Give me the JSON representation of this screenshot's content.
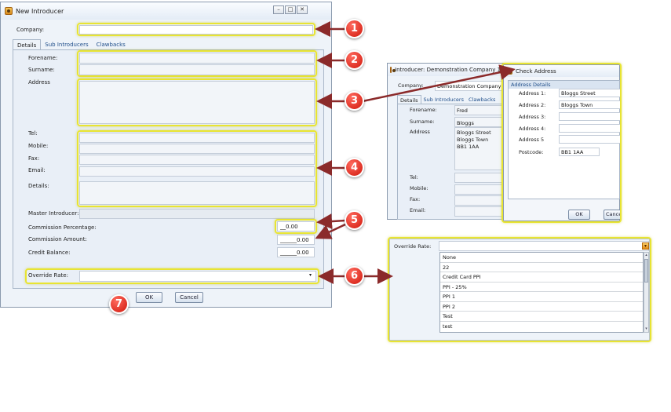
{
  "new_introducer": {
    "title": "New Introducer",
    "company_label": "Company:",
    "tabs": [
      "Details",
      "Sub Introducers",
      "Clawbacks"
    ],
    "forename_label": "Forename:",
    "surname_label": "Surname:",
    "address_label": "Address",
    "tel_label": "Tel:",
    "mobile_label": "Mobile:",
    "fax_label": "Fax:",
    "email_label": "Email:",
    "details_label": "Details:",
    "master_introducer_label": "Master Introducer:",
    "commission_percentage_label": "Commission Percentage:",
    "commission_percentage_value": "__0.00",
    "commission_amount_label": "Commission Amount:",
    "commission_amount_value": "______0.00",
    "credit_balance_label": "Credit Balance:",
    "credit_balance_value": "______0.00",
    "override_rate_label": "Override Rate:",
    "ok_label": "OK",
    "cancel_label": "Cancel"
  },
  "introducer_demo": {
    "title": "Introducer: Demonstration Company 1 - ID",
    "company_label": "Company:",
    "company_value": "Demonstration Company 1",
    "tabs": [
      "Details",
      "Sub Introducers",
      "Clawbacks"
    ],
    "forename_label": "Forename:",
    "forename_value": "Fred",
    "surname_label": "Surname:",
    "surname_value": "Bloggs",
    "address_label": "Address",
    "address_lines": [
      "Bloggs Street",
      "Bloggs Town",
      "BB1 1AA"
    ],
    "tel_label": "Tel:",
    "mobile_label": "Mobile:",
    "fax_label": "Fax:",
    "email_label": "Email:"
  },
  "check_address": {
    "title": "Check Address",
    "group_label": "Address Details",
    "address1_label": "Address 1:",
    "address1_value": "Bloggs Street",
    "address2_label": "Address 2:",
    "address2_value": "Bloggs Town",
    "address3_label": "Address 3:",
    "address4_label": "Address 4:",
    "address5_label": "Address 5",
    "postcode_label": "Postcode:",
    "postcode_value": "BB1 1AA",
    "ok_label": "OK",
    "cancel_label": "Cancel"
  },
  "override_dropdown": {
    "label": "Override Rate:",
    "options": [
      "None",
      "22",
      "Credit Card PPI",
      "PPI - 25%",
      "PPI 1",
      "PPI 2",
      "Test",
      "test"
    ]
  },
  "callouts": [
    "1",
    "2",
    "3",
    "4",
    "5",
    "6",
    "7"
  ],
  "colors": {
    "highlight": "#e8e432",
    "callout": "#d0180c",
    "arrow": "#8b2a2a",
    "link": "#1f4e8a"
  }
}
